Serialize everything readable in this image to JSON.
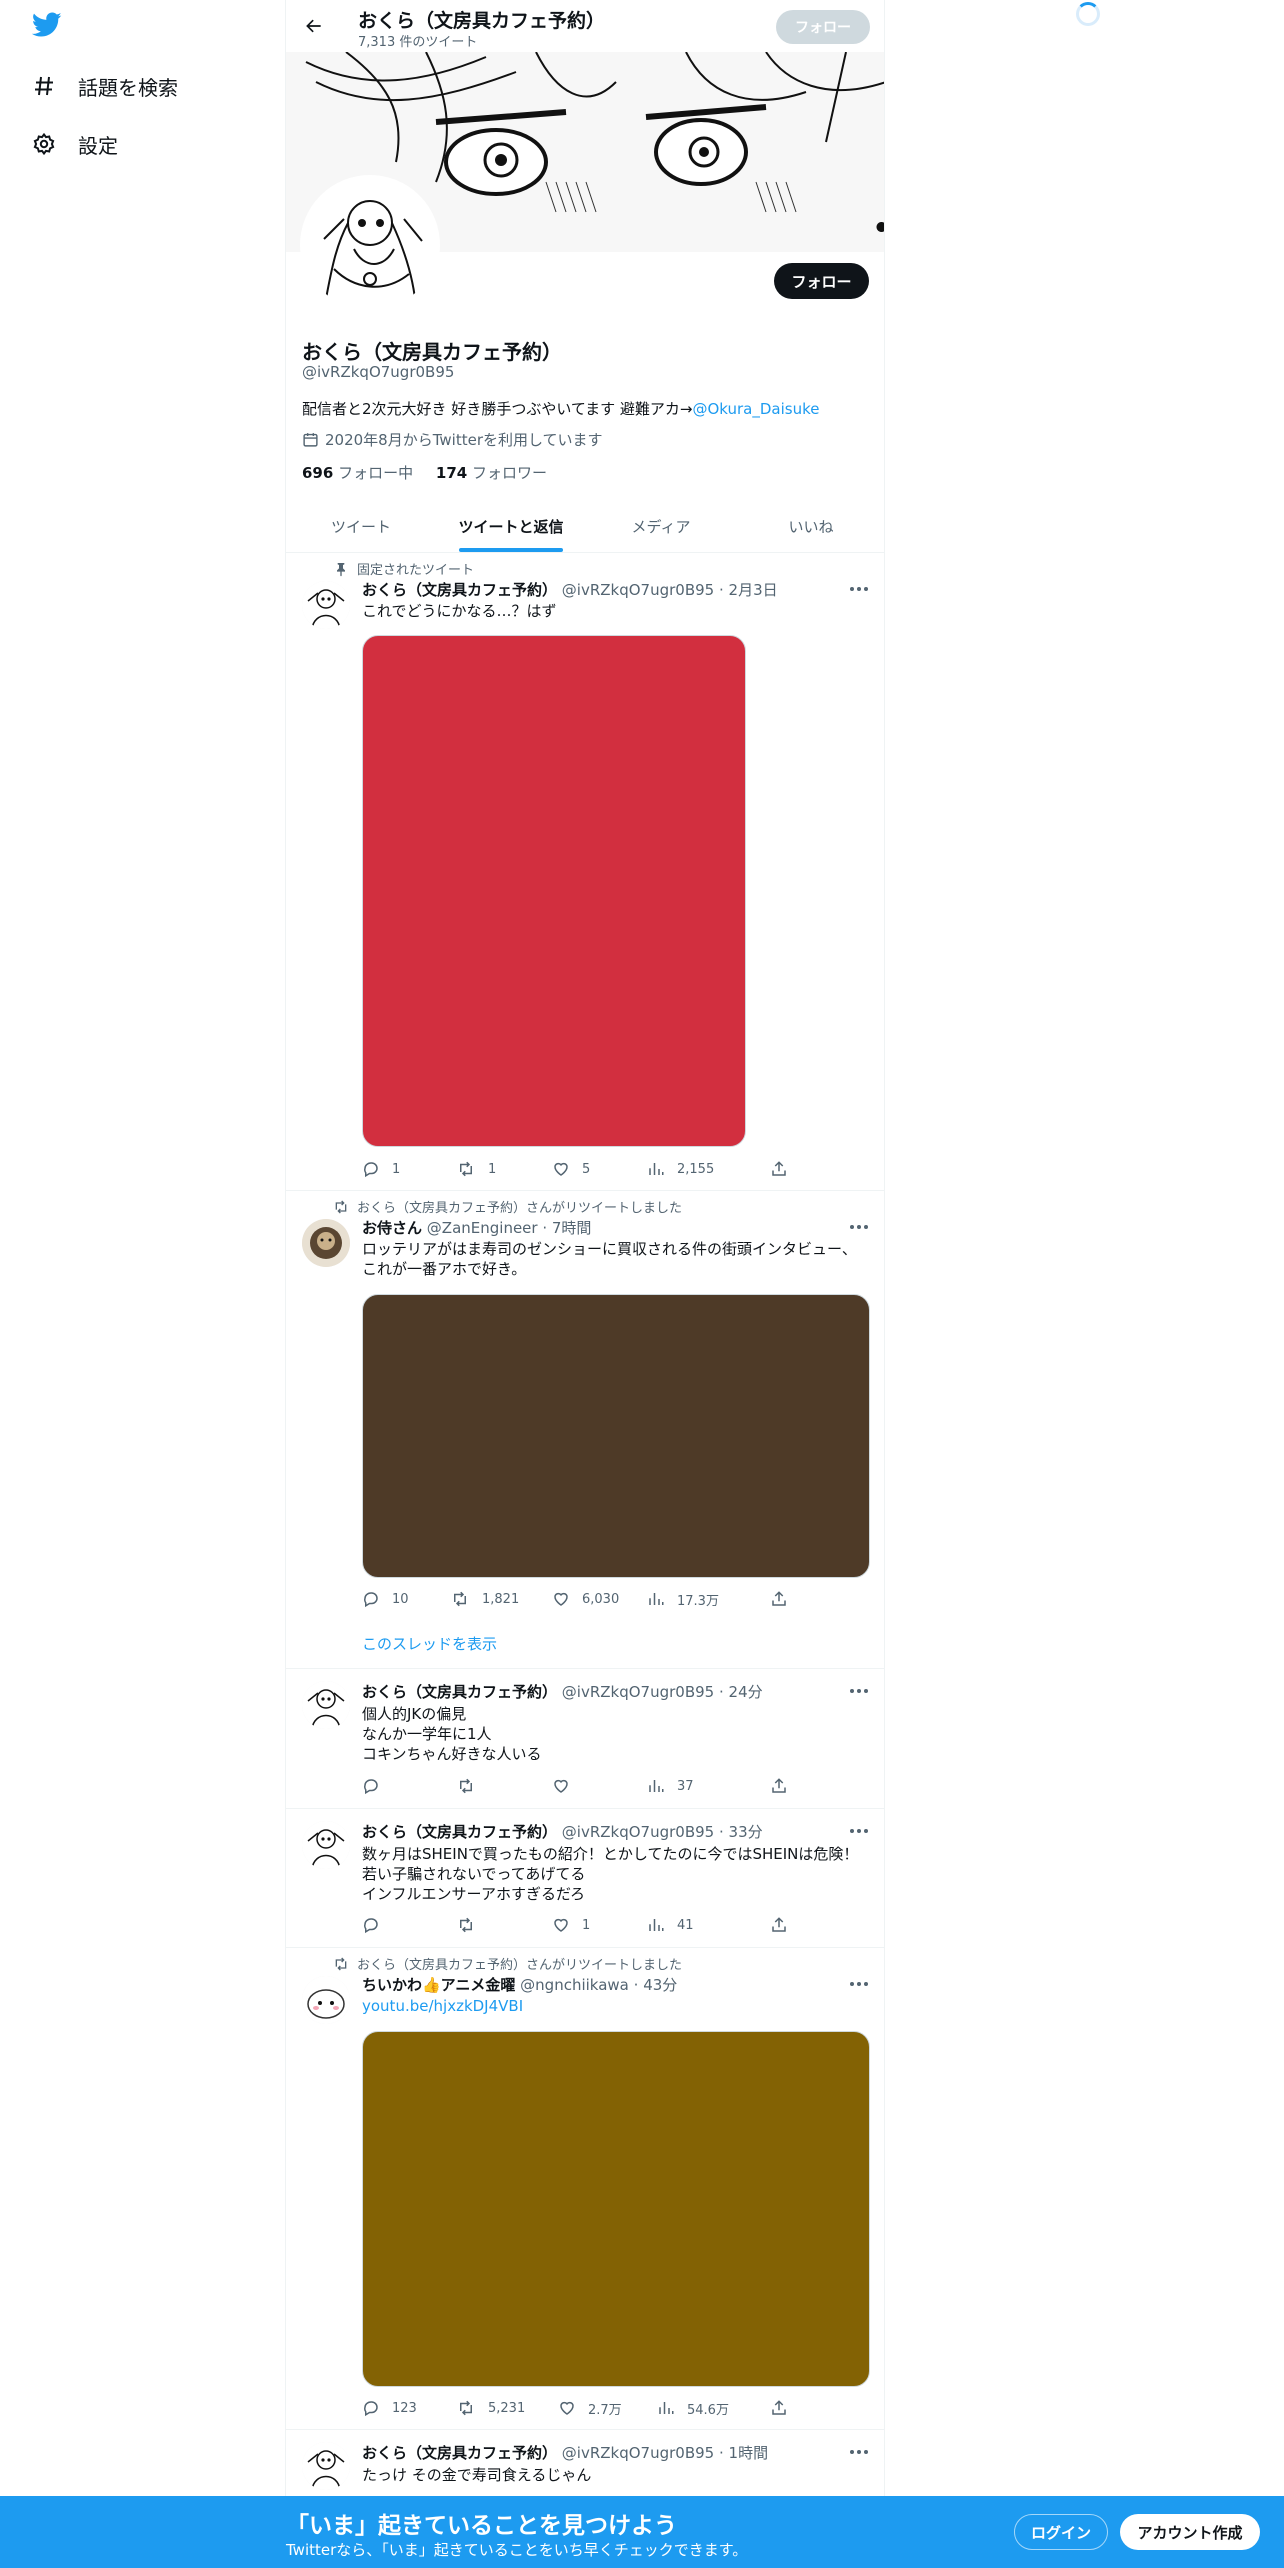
{
  "nav": {
    "explore_label": "話題を検索",
    "settings_label": "設定"
  },
  "header": {
    "name": "おくら（文房具カフェ予約）",
    "tweet_count": "7,313 件のツイート",
    "follow_label": "フォロー"
  },
  "profile": {
    "follow_label": "フォロー",
    "name": "おくら（文房具カフェ予約）",
    "handle": "@ivRZkqO7ugr0B95",
    "bio_text": "配信者と2次元大好き 好き勝手つぶやいてます 避難アカ→",
    "bio_link": "@Okura_Daisuke",
    "joined": "2020年8月からTwitterを利用しています",
    "following_count": "696",
    "following_label": "フォロー中",
    "followers_count": "174",
    "followers_label": "フォロワー"
  },
  "tabs": [
    "ツイート",
    "ツイートと返信",
    "メディア",
    "いいね"
  ],
  "tweets": [
    {
      "context": "固定されたツイート",
      "name": "おくら（文房具カフェ予約）",
      "handle": "@ivRZkqO7ugr0B95",
      "time": "2月3日",
      "text": "これでどうにかなる…？はず",
      "media_color": "#d22f3f",
      "replies": "1",
      "retweets": "1",
      "likes": "5",
      "views": "2,155"
    },
    {
      "context": "おくら（文房具カフェ予約）さんがリツイートしました",
      "name": "お侍さん",
      "handle": "@ZanEngineer",
      "time": "7時間",
      "text": "ロッテリアがはま寿司のゼンショーに買収される件の街頭インタビュー、\nこれが一番アホで好き。",
      "media_color": "#4e3a27",
      "replies": "10",
      "retweets": "1,821",
      "likes": "6,030",
      "views": "17.3万",
      "show_thread": "このスレッドを表示"
    },
    {
      "name": "おくら（文房具カフェ予約）",
      "handle": "@ivRZkqO7ugr0B95",
      "time": "24分",
      "text": "個人的JKの偏見\nなんか一学年に1人\nコキンちゃん好きな人いる",
      "replies": "",
      "retweets": "",
      "likes": "",
      "views": "37"
    },
    {
      "name": "おくら（文房具カフェ予約）",
      "handle": "@ivRZkqO7ugr0B95",
      "time": "33分",
      "text": "数ヶ月はSHEINで買ったもの紹介！とかしてたのに今ではSHEINは危険！\n若い子騙されないでってあげてる\nインフルエンサーアホすぎるだろ",
      "replies": "",
      "retweets": "",
      "likes": "1",
      "views": "41"
    },
    {
      "context": "おくら（文房具カフェ予約）さんがリツイートしました",
      "name": "ちいかわ👍アニメ金曜",
      "handle": "@ngnchiikawa",
      "time": "43分",
      "link": "youtu.be/hjxzkDJ4VBI",
      "media_color": "#836204",
      "replies": "123",
      "retweets": "5,231",
      "likes": "2.7万",
      "views": "54.6万"
    },
    {
      "name": "おくら（文房具カフェ予約）",
      "handle": "@ivRZkqO7ugr0B95",
      "time": "1時間",
      "text": "たっけ その金で寿司食えるじゃん"
    }
  ],
  "bottom_bar": {
    "headline": "「いま」起きていることを見つけよう",
    "subtext": "Twitterなら、「いま」起きていることをいち早くチェックできます。",
    "login_label": "ログイン",
    "signup_label": "アカウント作成"
  },
  "icons": {
    "logo": "twitter-bird-icon",
    "explore": "hashtag-icon",
    "settings": "gear-icon",
    "back": "arrow-left-icon",
    "calendar": "calendar-icon",
    "pin": "pin-icon",
    "retweeted": "retweet-icon",
    "reply": "reply-icon",
    "like": "heart-icon",
    "views": "views-chart-icon",
    "share": "share-icon",
    "more": "more-dots-icon"
  },
  "colors": {
    "accent": "#1d9bf0",
    "text": "#0f1419",
    "muted": "#536471"
  }
}
